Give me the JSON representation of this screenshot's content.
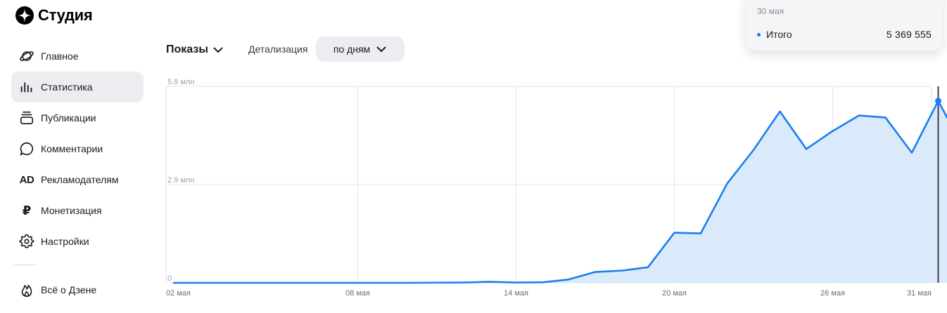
{
  "app": {
    "title": "Студия"
  },
  "sidebar": {
    "items": [
      {
        "label": "Главное",
        "icon": "planet-icon"
      },
      {
        "label": "Статистика",
        "icon": "bar-chart-icon",
        "active": true
      },
      {
        "label": "Публикации",
        "icon": "stack-icon"
      },
      {
        "label": "Комментарии",
        "icon": "comment-icon"
      },
      {
        "label": "Рекламодателям",
        "icon": "ad-icon"
      },
      {
        "label": "Монетизация",
        "icon": "ruble-icon"
      },
      {
        "label": "Настройки",
        "icon": "gear-icon"
      }
    ],
    "bottom_item": {
      "label": "Всё о Дзене",
      "icon": "flame-icon"
    }
  },
  "controls": {
    "metric_label": "Показы",
    "detail_label": "Детализация",
    "detail_value": "по дням"
  },
  "tooltip": {
    "date": "30 мая",
    "series_name": "Итого",
    "value": "5 369 555"
  },
  "colors": {
    "accent": "#1a7ff0",
    "fill": "#d8e9fb",
    "active_bg": "#ecedf0"
  },
  "chart_data": {
    "type": "area",
    "x": [
      "01 мая",
      "02 мая",
      "03 мая",
      "04 мая",
      "05 мая",
      "06 мая",
      "07 мая",
      "08 мая",
      "09 мая",
      "10 мая",
      "11 мая",
      "12 мая",
      "13 мая",
      "14 мая",
      "15 мая",
      "16 мая",
      "17 мая",
      "18 мая",
      "19 мая",
      "20 мая",
      "21 мая",
      "22 мая",
      "23 мая",
      "24 мая",
      "25 мая",
      "26 мая",
      "27 мая",
      "28 мая",
      "29 мая",
      "30 мая",
      "31 мая"
    ],
    "x_tick_labels": [
      "02 мая",
      "08 мая",
      "14 мая",
      "20 мая",
      "26 мая",
      "31 мая"
    ],
    "y_tick_labels": [
      "5.8 млн",
      "2.9 млн",
      "0"
    ],
    "ylim": [
      0,
      5800000
    ],
    "series": [
      {
        "values": [
          0,
          0,
          0,
          0,
          0,
          0,
          0,
          0,
          0,
          0,
          5000,
          10000,
          30000,
          10000,
          15000,
          100000,
          320000,
          360000,
          460000,
          1480000,
          1460000,
          2930000,
          3920000,
          5060000,
          3950000,
          4480000,
          4940000,
          4880000,
          3840000,
          5369555,
          3920000
        ]
      }
    ],
    "highlight_index": 29,
    "grid": true,
    "legend": "none"
  }
}
